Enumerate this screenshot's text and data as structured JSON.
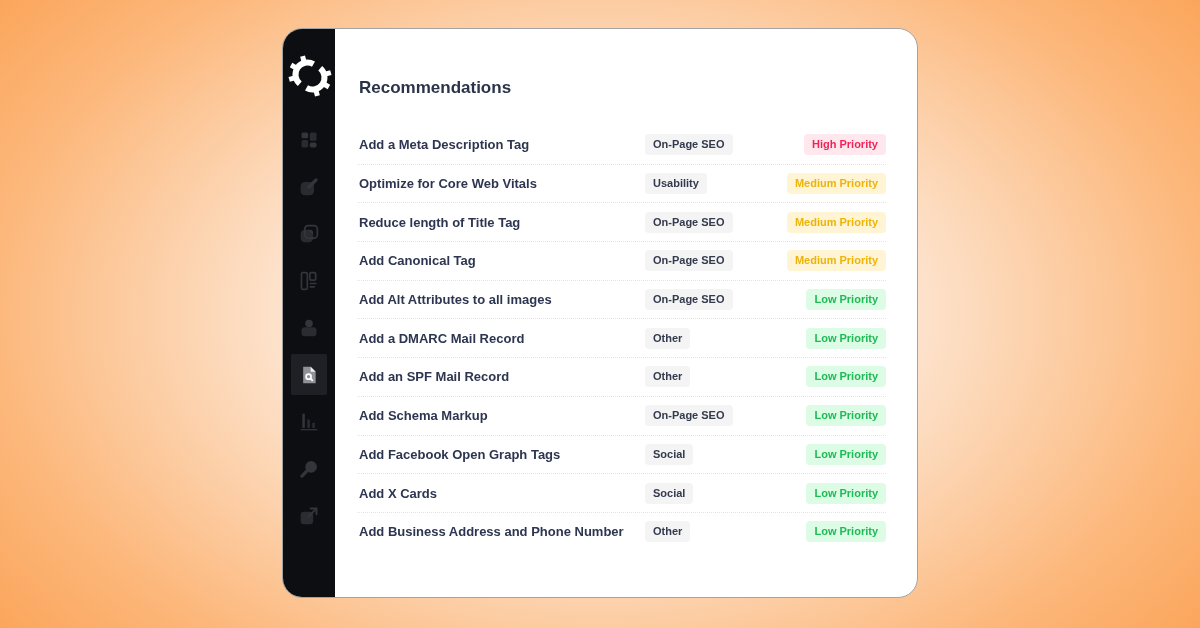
{
  "sidebar": {
    "items": [
      {
        "selected": false
      },
      {
        "selected": false
      },
      {
        "selected": false
      },
      {
        "selected": false
      },
      {
        "selected": false
      },
      {
        "selected": true
      },
      {
        "selected": false
      },
      {
        "selected": false
      },
      {
        "selected": false
      }
    ]
  },
  "recommendations": {
    "title": "Recommendations",
    "rows": [
      {
        "title": "Add a Meta Description Tag",
        "category": "On-Page SEO",
        "priority": {
          "label": "High Priority",
          "kind": "high"
        }
      },
      {
        "title": "Optimize for Core Web Vitals",
        "category": "Usability",
        "priority": {
          "label": "Medium Priority",
          "kind": "medium"
        }
      },
      {
        "title": "Reduce length of Title Tag",
        "category": "On-Page SEO",
        "priority": {
          "label": "Medium Priority",
          "kind": "medium"
        }
      },
      {
        "title": "Add Canonical Tag",
        "category": "On-Page SEO",
        "priority": {
          "label": "Medium Priority",
          "kind": "medium"
        }
      },
      {
        "title": "Add Alt Attributes to all images",
        "category": "On-Page SEO",
        "priority": {
          "label": "Low Priority",
          "kind": "low"
        }
      },
      {
        "title": "Add a DMARC Mail Record",
        "category": "Other",
        "priority": {
          "label": "Low Priority",
          "kind": "low"
        }
      },
      {
        "title": "Add an SPF Mail Record",
        "category": "Other",
        "priority": {
          "label": "Low Priority",
          "kind": "low"
        }
      },
      {
        "title": "Add Schema Markup",
        "category": "On-Page SEO",
        "priority": {
          "label": "Low Priority",
          "kind": "low"
        }
      },
      {
        "title": "Add Facebook Open Graph Tags",
        "category": "Social",
        "priority": {
          "label": "Low Priority",
          "kind": "low"
        }
      },
      {
        "title": "Add X Cards",
        "category": "Social",
        "priority": {
          "label": "Low Priority",
          "kind": "low"
        }
      },
      {
        "title": "Add Business Address and Phone Number",
        "category": "Other",
        "priority": {
          "label": "Low Priority",
          "kind": "low"
        }
      }
    ]
  }
}
